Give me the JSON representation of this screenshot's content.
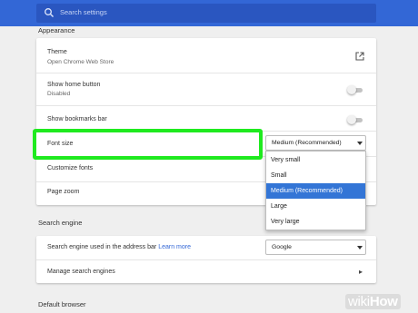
{
  "search": {
    "placeholder": "Search settings"
  },
  "appearance": {
    "heading": "Appearance",
    "theme": {
      "title": "Theme",
      "subtitle": "Open Chrome Web Store",
      "icon": "open-in-new-icon"
    },
    "home_button": {
      "title": "Show home button",
      "subtitle": "Disabled",
      "enabled": false
    },
    "bookmarks_bar": {
      "title": "Show bookmarks bar",
      "enabled": false
    },
    "font_size": {
      "title": "Font size",
      "selected": "Medium (Recommended)",
      "options": [
        "Very small",
        "Small",
        "Medium (Recommended)",
        "Large",
        "Very large"
      ]
    },
    "customize_fonts": {
      "title": "Customize fonts"
    },
    "page_zoom": {
      "title": "Page zoom"
    }
  },
  "search_engine": {
    "heading": "Search engine",
    "address_bar": {
      "title": "Search engine used in the address bar",
      "link": "Learn more",
      "selected": "Google"
    },
    "manage": {
      "title": "Manage search engines"
    }
  },
  "default_browser": {
    "heading": "Default browser"
  },
  "watermark": {
    "wiki": "wiki",
    "how": "How"
  },
  "colors": {
    "accent": "#3367d6",
    "highlight": "#1fea1f",
    "selected_option": "#3375d6"
  }
}
